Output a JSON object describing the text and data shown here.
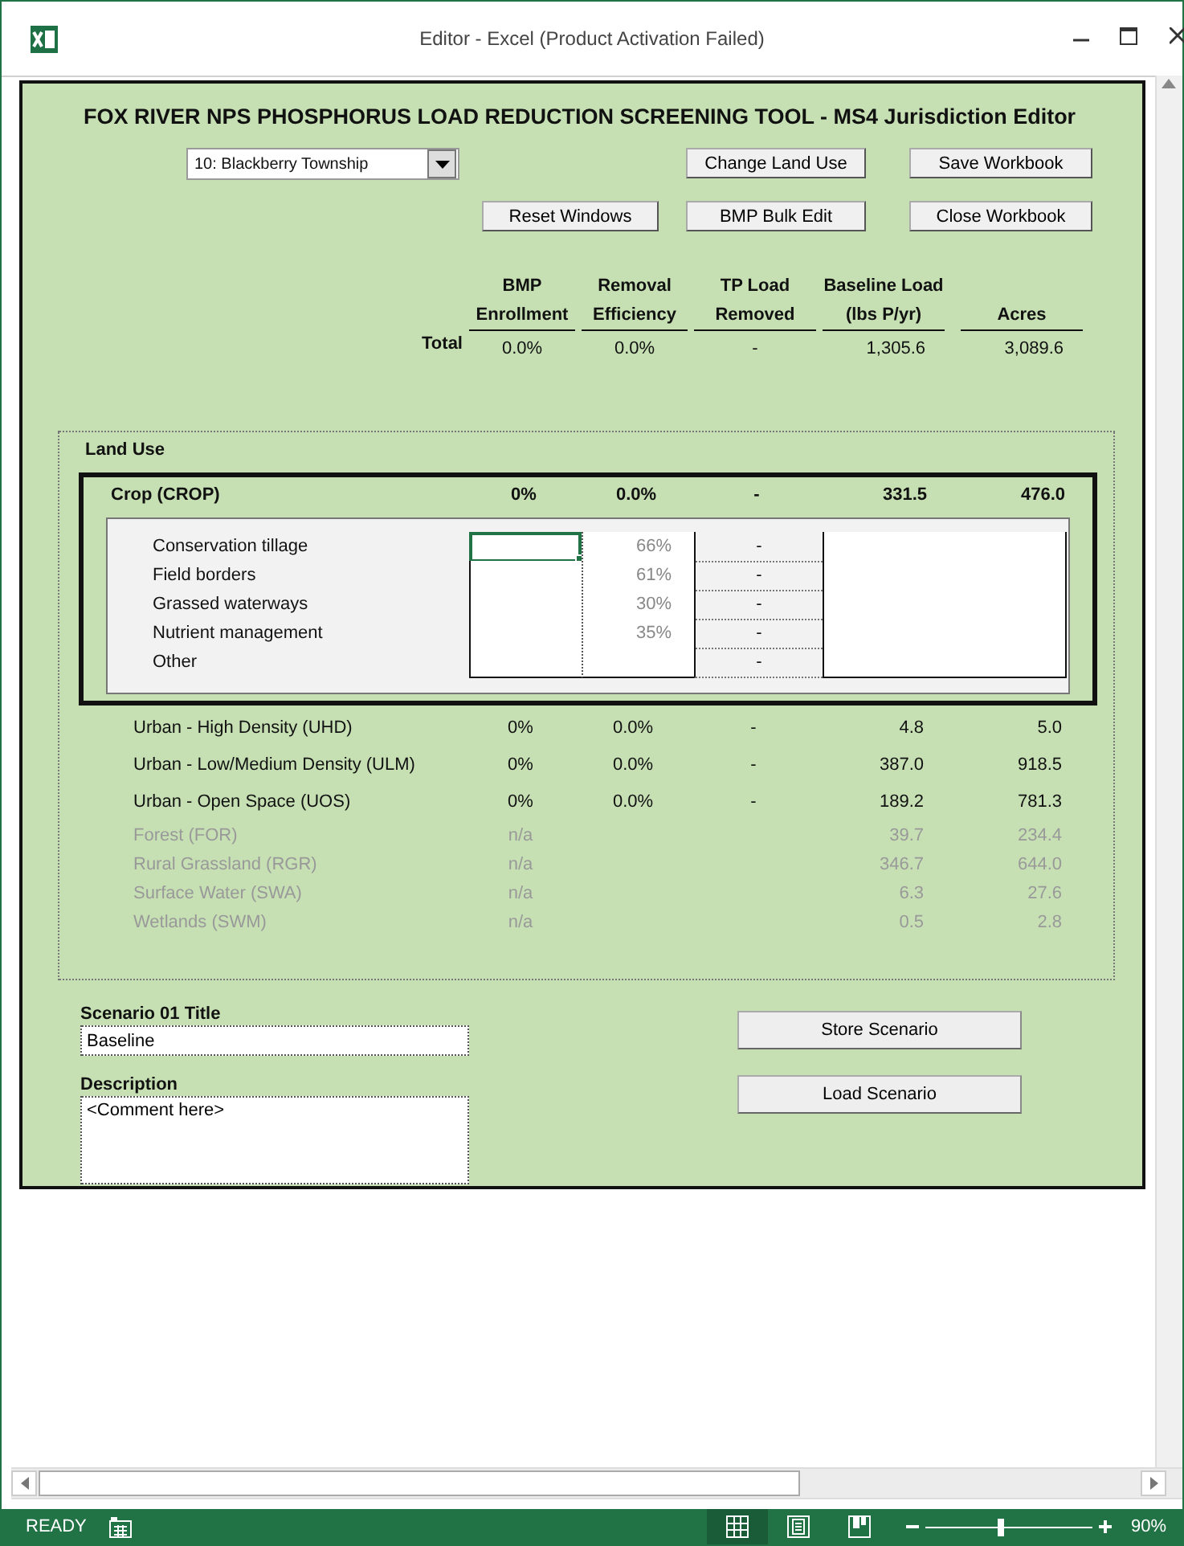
{
  "window": {
    "title": "Editor - Excel (Product Activation Failed)"
  },
  "tool": {
    "title": "FOX RIVER NPS PHOSPHORUS LOAD REDUCTION SCREENING TOOL - MS4 Jurisdiction Editor",
    "jurisdiction": "10: Blackberry Township",
    "buttons": [
      "Change Land Use",
      "Save Workbook",
      "Reset Windows",
      "BMP Bulk Edit",
      "Close Workbook"
    ],
    "columns": [
      [
        "BMP",
        "Enrollment"
      ],
      [
        "Removal",
        "Efficiency"
      ],
      [
        "TP Load",
        "Removed"
      ],
      [
        "Baseline Load",
        "(lbs P/yr)"
      ],
      [
        "Acres"
      ]
    ],
    "total": {
      "label": "Total",
      "enrollment": "0.0%",
      "efficiency": "0.0%",
      "removed": "-",
      "baseline": "1,305.6",
      "acres": "3,089.6"
    },
    "land_use": {
      "title": "Land Use",
      "crop": {
        "name": "Crop (CROP)",
        "enrollment": "0%",
        "efficiency": "0.0%",
        "removed": "-",
        "baseline": "331.5",
        "acres": "476.0",
        "bmps": [
          {
            "name": "Conservation tillage",
            "efficiency": "66%",
            "removed": "-",
            "selected": true
          },
          {
            "name": "Field borders",
            "efficiency": "61%",
            "removed": "-",
            "selected": false
          },
          {
            "name": "Grassed waterways",
            "efficiency": "30%",
            "removed": "-",
            "selected": false
          },
          {
            "name": "Nutrient management",
            "efficiency": "35%",
            "removed": "-",
            "selected": false
          },
          {
            "name": "Other",
            "removed": "-",
            "selected": false
          }
        ]
      },
      "rows": [
        {
          "name": "Urban - High Density (UHD)",
          "enrollment": "0%",
          "efficiency": "0.0%",
          "removed": "-",
          "baseline": "4.8",
          "acres": "5.0",
          "disabled": false
        },
        {
          "name": "Urban - Low/Medium Density (ULM)",
          "enrollment": "0%",
          "efficiency": "0.0%",
          "removed": "-",
          "baseline": "387.0",
          "acres": "918.5",
          "disabled": false
        },
        {
          "name": "Urban - Open Space (UOS)",
          "enrollment": "0%",
          "efficiency": "0.0%",
          "removed": "-",
          "baseline": "189.2",
          "acres": "781.3",
          "disabled": false
        },
        {
          "name": "Forest (FOR)",
          "enrollment": "n/a",
          "baseline": "39.7",
          "acres": "234.4",
          "disabled": true
        },
        {
          "name": "Rural Grassland (RGR)",
          "enrollment": "n/a",
          "baseline": "346.7",
          "acres": "644.0",
          "disabled": true
        },
        {
          "name": "Surface Water (SWA)",
          "enrollment": "n/a",
          "baseline": "6.3",
          "acres": "27.6",
          "disabled": true
        },
        {
          "name": "Wetlands (SWM)",
          "enrollment": "n/a",
          "baseline": "0.5",
          "acres": "2.8",
          "disabled": true
        }
      ]
    },
    "scenario": {
      "title_label": "Scenario 01 Title",
      "title_value": "Baseline",
      "description_label": "Description",
      "description_value": "<Comment here>",
      "buttons": [
        "Store Scenario",
        "Load Scenario"
      ]
    }
  },
  "status_bar": {
    "status": "READY",
    "views": [
      {
        "kind": "normal",
        "selected": true
      },
      {
        "kind": "page_layout",
        "selected": false
      },
      {
        "kind": "page_break",
        "selected": false
      }
    ],
    "zoom_slider": {
      "level": 0.45
    },
    "zoom": "90%"
  }
}
